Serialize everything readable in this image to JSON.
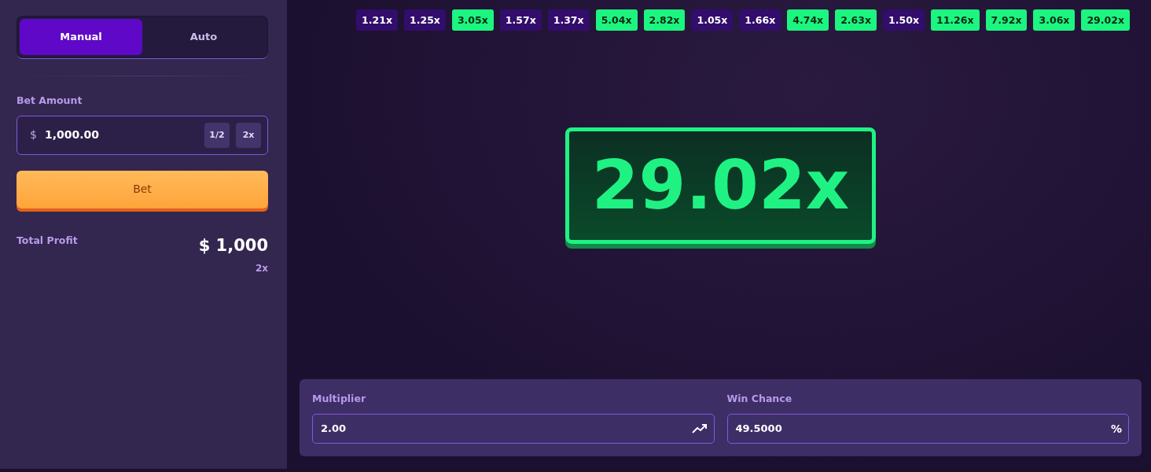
{
  "mode_tabs": [
    {
      "label": "Manual",
      "selected": true
    },
    {
      "label": "Auto",
      "selected": false
    }
  ],
  "bet_amount": {
    "label": "Bet Amount",
    "currency": "$",
    "value": "1,000.00",
    "half_button": "1/2",
    "double_button": "2x"
  },
  "bet_button": "Bet",
  "total_profit": {
    "label": "Total Profit",
    "amount": "$ 1,000",
    "multiplier": "2x"
  },
  "history": [
    {
      "value": "1.21x",
      "win": false
    },
    {
      "value": "1.25x",
      "win": false
    },
    {
      "value": "3.05x",
      "win": true
    },
    {
      "value": "1.57x",
      "win": false
    },
    {
      "value": "1.37x",
      "win": false
    },
    {
      "value": "5.04x",
      "win": true
    },
    {
      "value": "2.82x",
      "win": true
    },
    {
      "value": "1.05x",
      "win": false
    },
    {
      "value": "1.66x",
      "win": false
    },
    {
      "value": "4.74x",
      "win": true
    },
    {
      "value": "2.63x",
      "win": true
    },
    {
      "value": "1.50x",
      "win": false
    },
    {
      "value": "11.26x",
      "win": true
    },
    {
      "value": "7.92x",
      "win": true
    },
    {
      "value": "3.06x",
      "win": true
    },
    {
      "value": "29.02x",
      "win": true
    }
  ],
  "result": {
    "value": "29.02x",
    "win": true
  },
  "multiplier": {
    "label": "Multiplier",
    "value": "2.00"
  },
  "win_chance": {
    "label": "Win Chance",
    "value": "49.5000",
    "suffix": "%"
  }
}
